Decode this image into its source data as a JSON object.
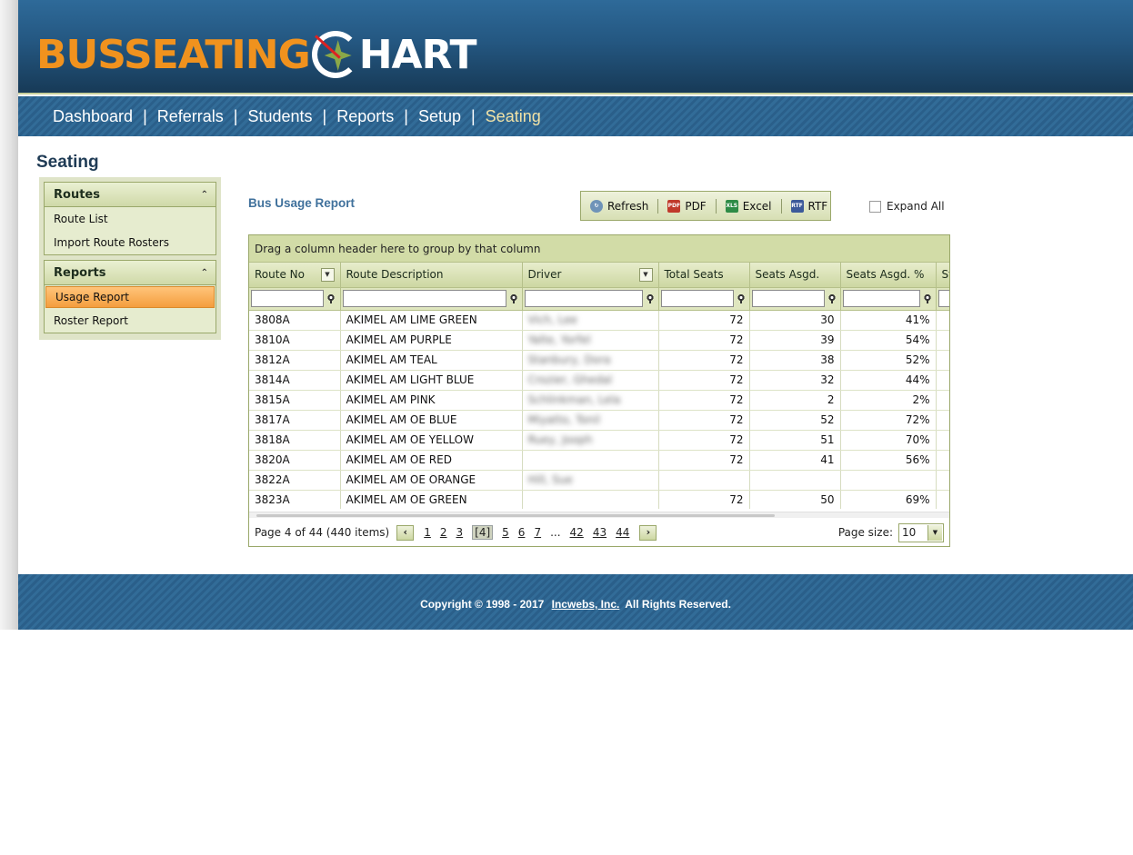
{
  "brand": {
    "logo_left": "BUSSEATING",
    "logo_right": "HART"
  },
  "nav": {
    "items": [
      "Dashboard",
      "Referrals",
      "Students",
      "Reports",
      "Setup",
      "Seating"
    ],
    "separator": "|",
    "active": "Seating"
  },
  "page_title": "Seating",
  "sidebar": {
    "routes": {
      "title": "Routes",
      "items": [
        "Route List",
        "Import Route Rosters"
      ]
    },
    "reports": {
      "title": "Reports",
      "items": [
        "Usage Report",
        "Roster Report"
      ],
      "selected": "Usage Report"
    }
  },
  "report": {
    "title": "Bus Usage Report",
    "toolbar": {
      "refresh": "Refresh",
      "pdf": "PDF",
      "excel": "Excel",
      "rtf": "RTF"
    },
    "expand_all": "Expand All",
    "group_hint": "Drag a column header here to group by that column",
    "columns": [
      "Route No",
      "Route Description",
      "Driver",
      "Total Seats",
      "Seats Asgd.",
      "Seats Asgd. %",
      "St"
    ],
    "rows": [
      {
        "route_no": "3808A",
        "description": "AKIMEL AM LIME GREEN",
        "driver": "Vich, Lee",
        "total": "72",
        "asgd": "30",
        "pct": "41%"
      },
      {
        "route_no": "3810A",
        "description": "AKIMEL AM PURPLE",
        "driver": "Yalte, Yorfel",
        "total": "72",
        "asgd": "39",
        "pct": "54%"
      },
      {
        "route_no": "3812A",
        "description": "AKIMEL AM TEAL",
        "driver": "Stanbury, Dora",
        "total": "72",
        "asgd": "38",
        "pct": "52%"
      },
      {
        "route_no": "3814A",
        "description": "AKIMEL AM LIGHT BLUE",
        "driver": "Crozier, Ghedal",
        "total": "72",
        "asgd": "32",
        "pct": "44%"
      },
      {
        "route_no": "3815A",
        "description": "AKIMEL AM PINK",
        "driver": "Schlinkman, Lela",
        "total": "72",
        "asgd": "2",
        "pct": "2%"
      },
      {
        "route_no": "3817A",
        "description": "AKIMEL AM OE BLUE",
        "driver": "Miyatto, Tonil",
        "total": "72",
        "asgd": "52",
        "pct": "72%"
      },
      {
        "route_no": "3818A",
        "description": "AKIMEL AM OE YELLOW",
        "driver": "Ruey, Jooph",
        "total": "72",
        "asgd": "51",
        "pct": "70%"
      },
      {
        "route_no": "3820A",
        "description": "AKIMEL AM OE RED",
        "driver": "",
        "total": "72",
        "asgd": "41",
        "pct": "56%"
      },
      {
        "route_no": "3822A",
        "description": "AKIMEL AM OE ORANGE",
        "driver": "Hill, Sue",
        "total": "",
        "asgd": "",
        "pct": ""
      },
      {
        "route_no": "3823A",
        "description": "AKIMEL AM OE GREEN",
        "driver": "",
        "total": "72",
        "asgd": "50",
        "pct": "69%"
      }
    ],
    "pager": {
      "summary": "Page 4 of 44 (440 items)",
      "pages": [
        "1",
        "2",
        "3",
        "[4]",
        "5",
        "6",
        "7",
        "...",
        "42",
        "43",
        "44"
      ],
      "current": "[4]",
      "page_size_label": "Page size:",
      "page_size": "10"
    }
  },
  "footer": {
    "copyright": "Copyright © 1998 - 2017",
    "company": "Incwebs, Inc.",
    "rights": "All Rights Reserved."
  },
  "colors": {
    "header": "#245781",
    "nav_active": "#f1e2a6",
    "grid_header": "#cdd7a2",
    "selected": "#f49e3e",
    "logo_orange": "#f0921e"
  }
}
